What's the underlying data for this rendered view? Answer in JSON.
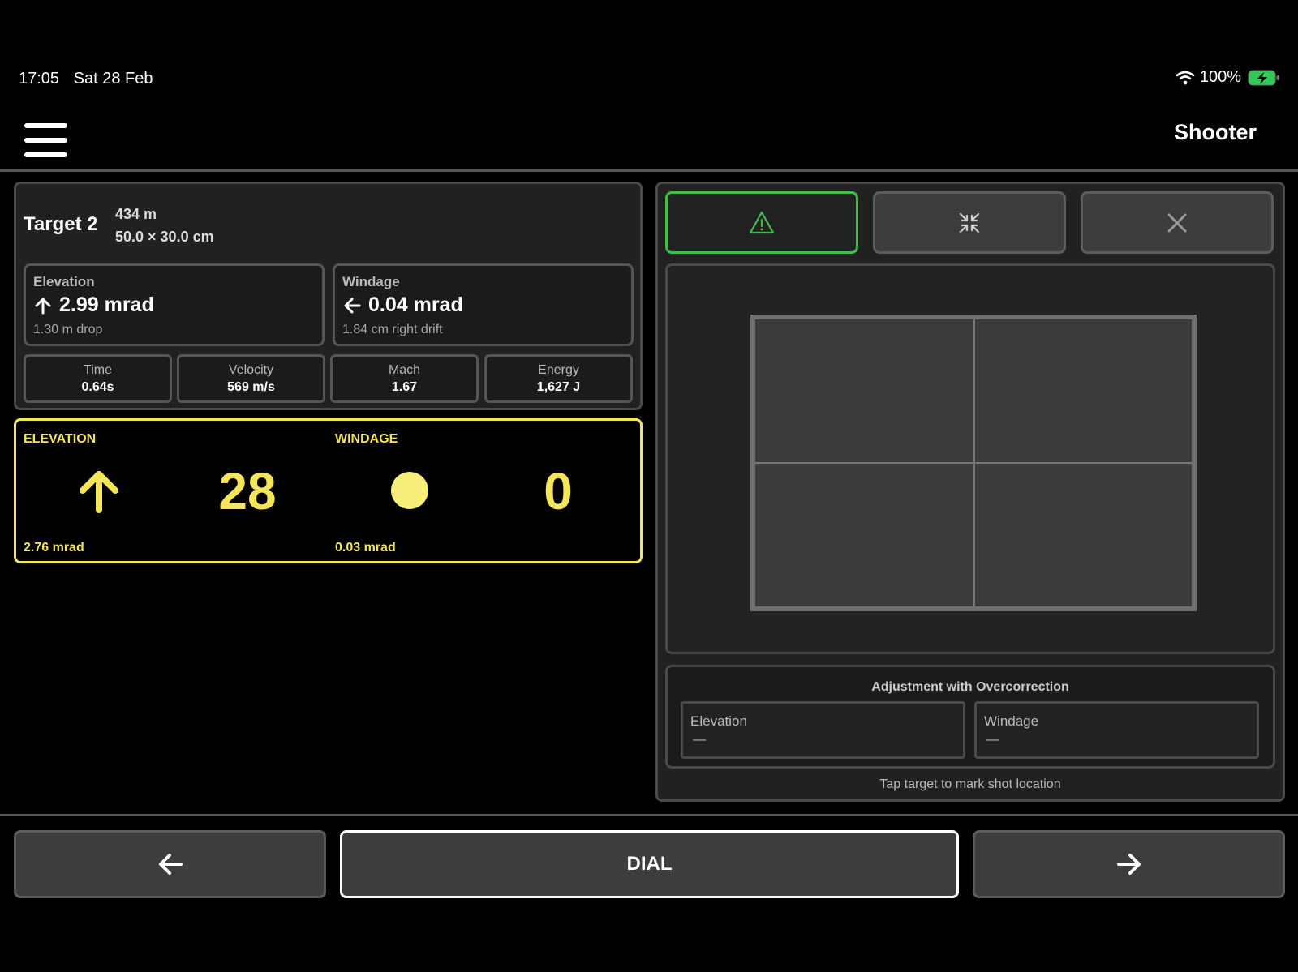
{
  "status": {
    "time": "17:05",
    "date": "Sat 28 Feb",
    "battery": "100%"
  },
  "header": {
    "title": "Shooter"
  },
  "target": {
    "name": "Target 2",
    "range": "434 m",
    "size": "50.0 × 30.0 cm"
  },
  "elevation_card": {
    "label": "Elevation",
    "value": "2.99 mrad",
    "sub": "1.30 m drop"
  },
  "windage_card": {
    "label": "Windage",
    "value": "0.04 mrad",
    "sub": "1.84 cm right drift"
  },
  "stats": [
    {
      "label": "Time",
      "value": "0.64s"
    },
    {
      "label": "Velocity",
      "value": "569 m/s"
    },
    {
      "label": "Mach",
      "value": "1.67"
    },
    {
      "label": "Energy",
      "value": "1,627 J"
    }
  ],
  "dial": {
    "elevation": {
      "label": "ELEVATION",
      "clicks": "28",
      "mrad": "2.76 mrad"
    },
    "windage": {
      "label": "WINDAGE",
      "clicks": "0",
      "mrad": "0.03 mrad"
    }
  },
  "adjustment": {
    "title": "Adjustment with Overcorrection",
    "elevation": {
      "label": "Elevation",
      "value": "—"
    },
    "windage": {
      "label": "Windage",
      "value": "—"
    }
  },
  "tap_hint": "Tap target to mark shot location",
  "nav": {
    "dial_label": "DIAL"
  },
  "colors": {
    "accent_yellow": "#f5e55a",
    "active_green": "#3fbf4a",
    "battery_green": "#34c759"
  }
}
